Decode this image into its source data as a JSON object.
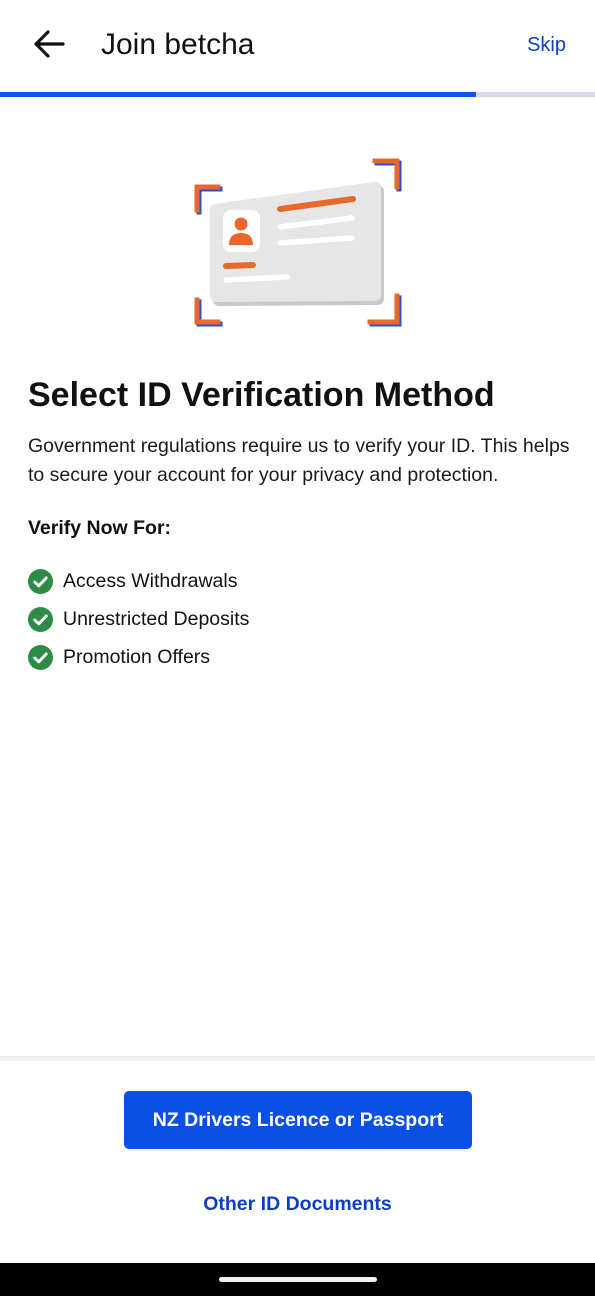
{
  "header": {
    "title": "Join betcha",
    "back_icon": "arrow-left-icon",
    "skip_label": "Skip"
  },
  "progress": {
    "fraction": 0.8,
    "fill_color": "#0a56e6",
    "track_color": "#dcd6e6"
  },
  "illustration": {
    "icon": "id-card-scan-icon",
    "accent_color": "#e8682c",
    "frame_color": "#2b4fd1"
  },
  "main": {
    "heading": "Select ID Verification Method",
    "description": "Government regulations require us to verify your ID. This helps to secure your account for your privacy and protection.",
    "verify_label": "Verify Now For:",
    "benefits": [
      {
        "label": "Access Withdrawals",
        "icon": "check-circle-icon"
      },
      {
        "label": "Unrestricted Deposits",
        "icon": "check-circle-icon"
      },
      {
        "label": "Promotion Offers",
        "icon": "check-circle-icon"
      }
    ],
    "check_color": "#2e8b45"
  },
  "actions": {
    "primary_label": "NZ Drivers Licence or Passport",
    "secondary_label": "Other ID Documents",
    "primary_color": "#0a4fe6",
    "link_color": "#0a3fc4"
  }
}
